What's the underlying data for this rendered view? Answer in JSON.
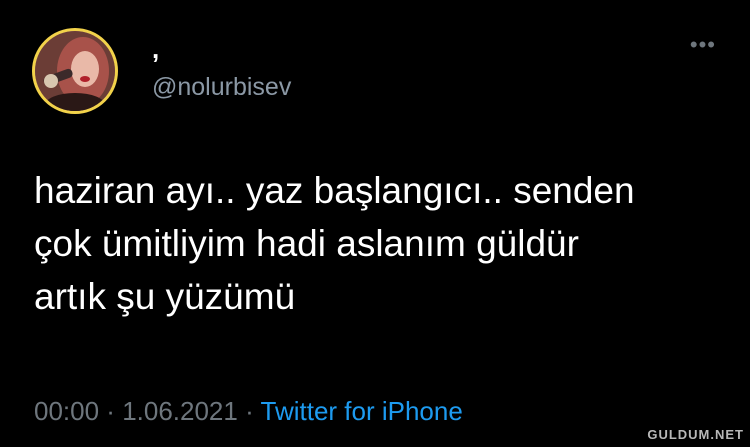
{
  "profile": {
    "display_name": ",",
    "handle": "@nolurbisev",
    "avatar_border_color": "#f2d24a"
  },
  "more_icon": "more-horizontal-icon",
  "tweet": {
    "lines": [
      "haziran ayı.. yaz başlangıcı.. senden",
      "çok ümitliyim hadi aslanım güldür",
      "artık şu yüzümü"
    ]
  },
  "meta": {
    "time": "00:00",
    "separator_1": " · ",
    "date": "1.06.2021",
    "separator_2": " · ",
    "source": "Twitter for iPhone"
  },
  "watermark": "GULDUM.NET",
  "colors": {
    "background": "#000000",
    "text": "#ffffff",
    "secondary": "#6e767d",
    "link": "#1d9bf0"
  }
}
